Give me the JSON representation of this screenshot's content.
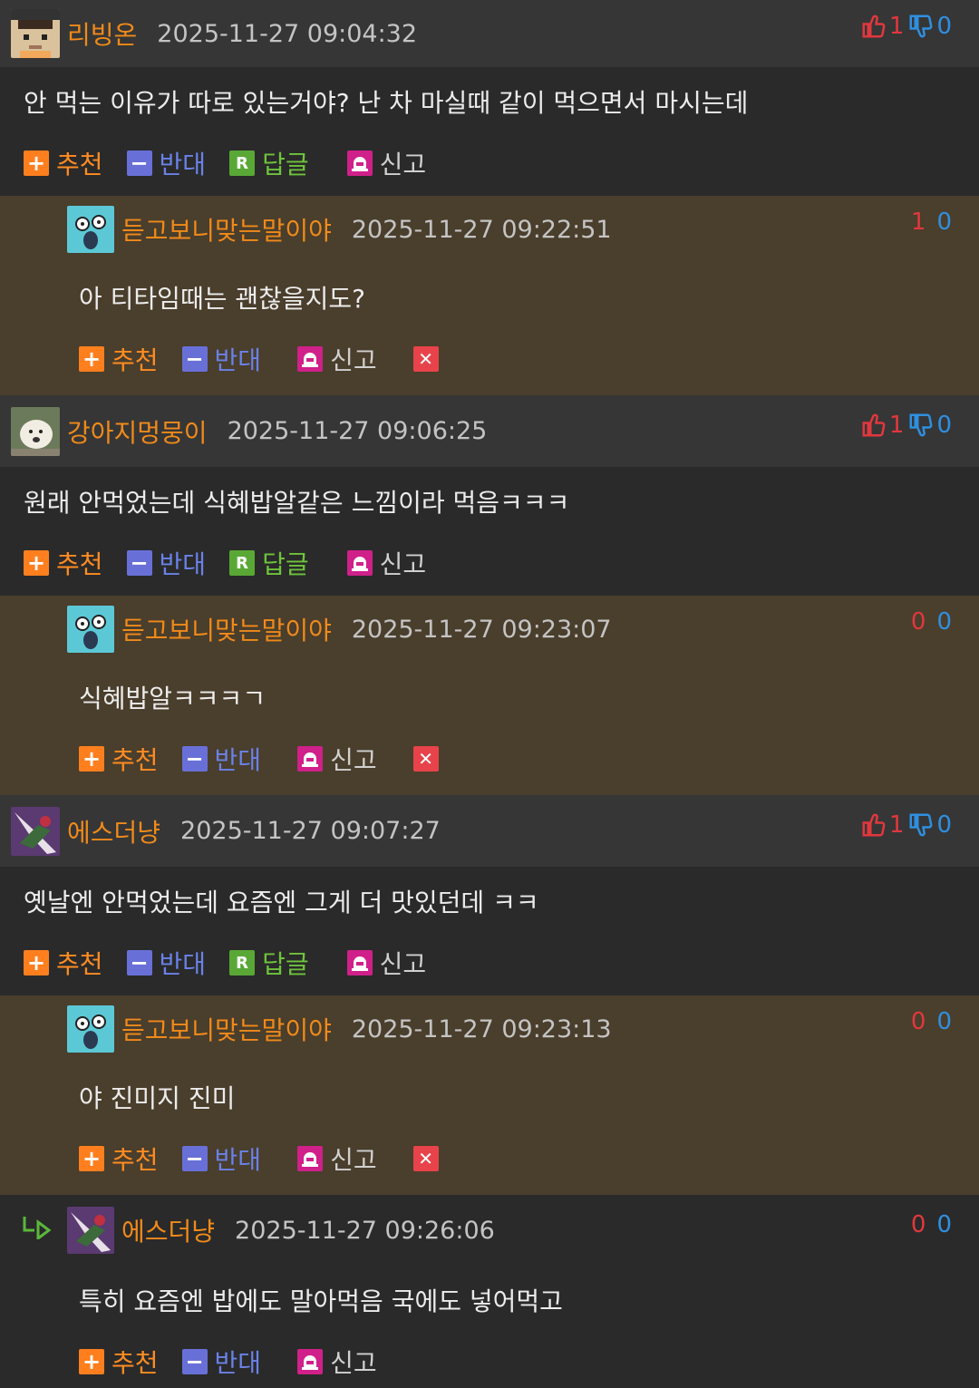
{
  "labels": {
    "recommend": "추천",
    "oppose": "반대",
    "reply": "답글",
    "report": "신고"
  },
  "comments": [
    {
      "name": "리빙온",
      "time": "2025-11-27 09:04:32",
      "up": "1",
      "down": "0",
      "text": "안 먹는 이유가 따로 있는거야? 난 차 마실때 같이 먹으면서 마시는데"
    },
    {
      "name": "듣고보니맞는말이야",
      "time": "2025-11-27 09:22:51",
      "up": "1",
      "down": "0",
      "text": "아 티타임때는 괜찮을지도?"
    },
    {
      "name": "강아지멍뭉이",
      "time": "2025-11-27 09:06:25",
      "up": "1",
      "down": "0",
      "text": "원래 안먹었는데 식혜밥알같은 느낌이라 먹음ㅋㅋㅋ"
    },
    {
      "name": "듣고보니맞는말이야",
      "time": "2025-11-27 09:23:07",
      "up": "0",
      "down": "0",
      "text": "식혜밥알ㅋㅋㅋㄱ"
    },
    {
      "name": "에스더냥",
      "time": "2025-11-27 09:07:27",
      "up": "1",
      "down": "0",
      "text": "옛날엔 안먹었는데 요즘엔 그게 더 맛있던데 ㅋㅋ"
    },
    {
      "name": "듣고보니맞는말이야",
      "time": "2025-11-27 09:23:13",
      "up": "0",
      "down": "0",
      "text": "야 진미지 진미"
    },
    {
      "name": "에스더냥",
      "time": "2025-11-27 09:26:06",
      "up": "0",
      "down": "0",
      "text": "특히 요즘엔 밥에도 말아먹음 국에도 넣어먹고"
    }
  ],
  "colors": {
    "name": "#f08a1a",
    "upvote": "#e0383e",
    "downvote": "#2f8fe0",
    "reply_bg": "#4a3e2c",
    "header_bg": "#363636",
    "page_bg": "#2a2a2a"
  }
}
